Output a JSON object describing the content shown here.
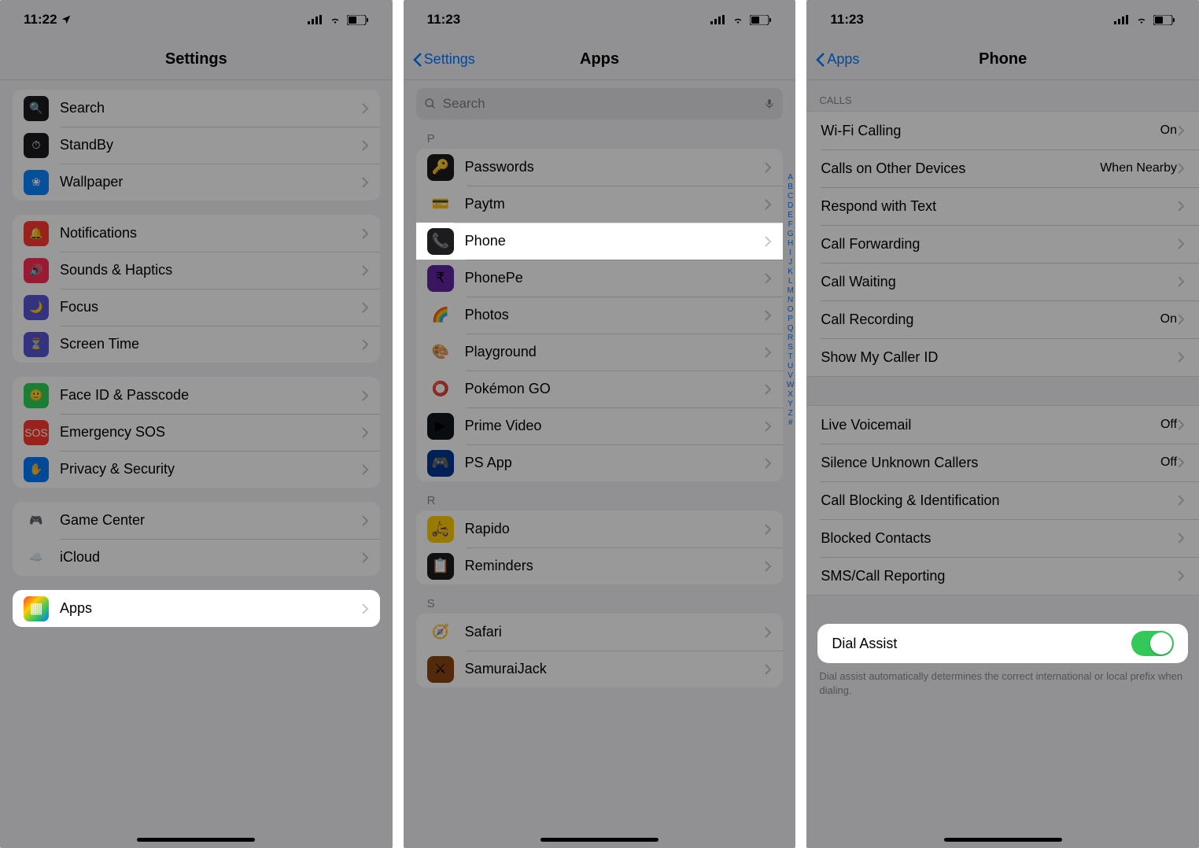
{
  "panel1": {
    "status": {
      "time": "11:22"
    },
    "title": "Settings",
    "groups": [
      [
        {
          "icon_bg": "#1c1c1e",
          "icon_color": "#fff",
          "icon": "🔍",
          "name": "search",
          "label": "Search"
        },
        {
          "icon_bg": "#1c1c1e",
          "icon_color": "#fff",
          "icon": "⏱",
          "name": "standby",
          "label": "StandBy"
        },
        {
          "icon_bg": "#0a84ff",
          "icon_color": "#fff",
          "icon": "❀",
          "name": "wallpaper",
          "label": "Wallpaper"
        }
      ],
      [
        {
          "icon_bg": "#ff3b30",
          "icon_color": "#fff",
          "icon": "🔔",
          "name": "notifications",
          "label": "Notifications"
        },
        {
          "icon_bg": "#ff2d55",
          "icon_color": "#fff",
          "icon": "🔊",
          "name": "sounds-haptics",
          "label": "Sounds & Haptics"
        },
        {
          "icon_bg": "#5856d6",
          "icon_color": "#fff",
          "icon": "🌙",
          "name": "focus",
          "label": "Focus"
        },
        {
          "icon_bg": "#5856d6",
          "icon_color": "#fff",
          "icon": "⏳",
          "name": "screen-time",
          "label": "Screen Time"
        }
      ],
      [
        {
          "icon_bg": "#30d158",
          "icon_color": "#fff",
          "icon": "🙂",
          "name": "faceid-passcode",
          "label": "Face ID & Passcode"
        },
        {
          "icon_bg": "#ff3b30",
          "icon_color": "#fff",
          "icon": "SOS",
          "name": "emergency-sos",
          "label": "Emergency SOS"
        },
        {
          "icon_bg": "#007aff",
          "icon_color": "#fff",
          "icon": "✋",
          "name": "privacy-security",
          "label": "Privacy & Security"
        }
      ],
      [
        {
          "icon_bg": "#ffffff",
          "icon_color": "#000",
          "icon": "🎮",
          "name": "game-center",
          "label": "Game Center"
        },
        {
          "icon_bg": "#ffffff",
          "icon_color": "#000",
          "icon": "☁️",
          "name": "icloud",
          "label": "iCloud"
        }
      ]
    ],
    "apps_row": {
      "icon": "🔳",
      "label": "Apps",
      "name": "apps"
    }
  },
  "panel2": {
    "status": {
      "time": "11:23"
    },
    "back": "Settings",
    "title": "Apps",
    "search_placeholder": "Search",
    "index_letters": [
      "A",
      "B",
      "C",
      "D",
      "E",
      "F",
      "G",
      "H",
      "I",
      "J",
      "K",
      "L",
      "M",
      "N",
      "O",
      "P",
      "Q",
      "R",
      "S",
      "T",
      "U",
      "V",
      "W",
      "X",
      "Y",
      "Z",
      "#"
    ],
    "sections": [
      {
        "letter": "P",
        "apps": [
          {
            "name": "passwords",
            "label": "Passwords",
            "bg": "#1c1c1e",
            "emoji": "🔑"
          },
          {
            "name": "paytm",
            "label": "Paytm",
            "bg": "#ffffff",
            "emoji": "💳"
          },
          {
            "name": "phone",
            "label": "Phone",
            "bg": "#1c1c1e",
            "emoji": "📞",
            "highlight": true
          },
          {
            "name": "phonepe",
            "label": "PhonePe",
            "bg": "#5f259f",
            "emoji": "₹"
          },
          {
            "name": "photos",
            "label": "Photos",
            "bg": "#ffffff",
            "emoji": "🌈"
          },
          {
            "name": "playground",
            "label": "Playground",
            "bg": "#ffffff",
            "emoji": "🎨"
          },
          {
            "name": "pokemon-go",
            "label": "Pokémon GO",
            "bg": "#ffffff",
            "emoji": "⭕"
          },
          {
            "name": "prime-video",
            "label": "Prime Video",
            "bg": "#0f171e",
            "emoji": "▶"
          },
          {
            "name": "ps-app",
            "label": "PS App",
            "bg": "#003791",
            "emoji": "🎮"
          }
        ]
      },
      {
        "letter": "R",
        "apps": [
          {
            "name": "rapido",
            "label": "Rapido",
            "bg": "#ffcc00",
            "emoji": "🛵"
          },
          {
            "name": "reminders",
            "label": "Reminders",
            "bg": "#1c1c1e",
            "emoji": "📋"
          }
        ]
      },
      {
        "letter": "S",
        "apps": [
          {
            "name": "safari",
            "label": "Safari",
            "bg": "#ffffff",
            "emoji": "🧭"
          },
          {
            "name": "samuraijack",
            "label": "SamuraiJack",
            "bg": "#8b4513",
            "emoji": "⚔"
          }
        ]
      }
    ]
  },
  "panel3": {
    "status": {
      "time": "11:23"
    },
    "back": "Apps",
    "title": "Phone",
    "section_header": "CALLS",
    "rows_calls": [
      {
        "name": "wifi-calling",
        "label": "Wi-Fi Calling",
        "value": "On"
      },
      {
        "name": "calls-other-devices",
        "label": "Calls on Other Devices",
        "value": "When Nearby"
      },
      {
        "name": "respond-with-text",
        "label": "Respond with Text",
        "value": ""
      },
      {
        "name": "call-forwarding",
        "label": "Call Forwarding",
        "value": ""
      },
      {
        "name": "call-waiting",
        "label": "Call Waiting",
        "value": ""
      },
      {
        "name": "call-recording",
        "label": "Call Recording",
        "value": "On"
      },
      {
        "name": "show-caller-id",
        "label": "Show My Caller ID",
        "value": ""
      }
    ],
    "rows_group2": [
      {
        "name": "live-voicemail",
        "label": "Live Voicemail",
        "value": "Off"
      },
      {
        "name": "silence-unknown",
        "label": "Silence Unknown Callers",
        "value": "Off"
      },
      {
        "name": "call-blocking",
        "label": "Call Blocking & Identification",
        "value": ""
      },
      {
        "name": "blocked-contacts",
        "label": "Blocked Contacts",
        "value": ""
      },
      {
        "name": "sms-call-reporting",
        "label": "SMS/Call Reporting",
        "value": ""
      }
    ],
    "dial_assist": {
      "label": "Dial Assist",
      "on": true
    },
    "footer": "Dial assist automatically determines the correct international or local prefix when dialing."
  }
}
